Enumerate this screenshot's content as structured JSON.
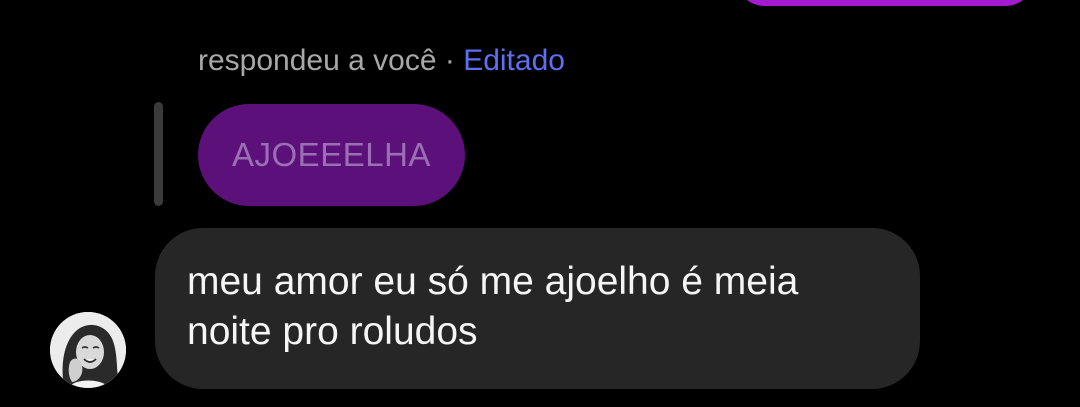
{
  "previous_message": {
    "bubble_color": "#a21bd1"
  },
  "reply_header": {
    "meta_text": "respondeu a você",
    "separator": "·",
    "edited_label": "Editado",
    "edited_color": "#5f6ef2"
  },
  "quoted_message": {
    "text": "AJOEEELHA",
    "bubble_color": "#5b1179"
  },
  "message": {
    "lines": [
      "meu amor eu só me ajoelho é meia",
      "noite pro roludos"
    ],
    "bubble_color": "#262626"
  },
  "sender": {
    "avatar_icon": "profile-photo-avatar"
  }
}
